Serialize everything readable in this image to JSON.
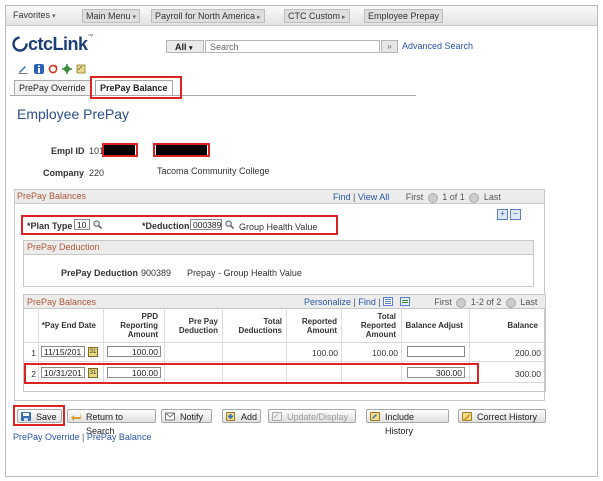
{
  "breadcrumbs": [
    {
      "label": "Favorites",
      "arrow": "▾"
    },
    {
      "label": "Main Menu",
      "arrow": "▾"
    },
    {
      "label": "Payroll for North America",
      "arrow": "▸"
    },
    {
      "label": "CTC Custom",
      "arrow": "▸"
    },
    {
      "label": "Employee Prepay",
      "arrow": ""
    }
  ],
  "header": {
    "logo": "ctcLink",
    "logo_mark": "™",
    "search_scope": "All",
    "search_scope_arrow": "▾",
    "search_placeholder": "Search",
    "search_go": "»",
    "advanced_search": "Advanced Search"
  },
  "tabs": [
    {
      "label": "PrePay Override",
      "active": false
    },
    {
      "label": "PrePay Balance",
      "active": true
    }
  ],
  "page_title": "Employee PrePay",
  "employee": {
    "empl_id_label": "Empl ID",
    "empl_id_prefix": "101",
    "company_label": "Company",
    "company_code": "220",
    "company_name": "Tacoma Community College"
  },
  "prepay_balances": {
    "title": "PrePay Balances",
    "find": "Find",
    "view_all": "View All",
    "first": "First",
    "range": "1 of 1",
    "last": "Last",
    "add_glyph": "+",
    "remove_glyph": "−",
    "plan_type_label": "*Plan Type",
    "plan_type_value": "10",
    "deduction_label": "*Deduction",
    "deduction_value": "000389",
    "deduction_desc": "Group Health Value"
  },
  "prepay_deduction": {
    "title": "PrePay Deduction",
    "label": "PrePay Deduction",
    "code": "900389",
    "desc": "Prepay - Group Health Value"
  },
  "grid": {
    "title": "PrePay Balances",
    "personalize": "Personalize",
    "find": "Find",
    "first": "First",
    "range": "1-2 of 2",
    "last": "Last",
    "columns": {
      "pay_end_date": "*Pay End Date",
      "ppd_reporting": "PPD Reporting Amount",
      "prepay_deduction": "Pre Pay Deduction",
      "total_deductions": "Total Deductions",
      "reported_amount": "Reported Amount",
      "total_reported": "Total Reported Amount",
      "balance_adjust": "Balance Adjust",
      "balance": "Balance"
    },
    "rows": [
      {
        "num": "1",
        "date": "11/15/201",
        "ppd": "100.00",
        "prepay_ded": "",
        "total_ded": "",
        "reported": "100.00",
        "total_reported": "100.00",
        "balance_adjust": "",
        "balance": "200.00"
      },
      {
        "num": "2",
        "date": "10/31/201",
        "ppd": "100.00",
        "prepay_ded": "",
        "total_ded": "",
        "reported": "",
        "total_reported": "",
        "balance_adjust": "300.00",
        "balance": "300.00"
      }
    ]
  },
  "buttons": {
    "save": "Save",
    "return_to_search": "Return to Search",
    "notify": "Notify",
    "add": "Add",
    "update_display": "Update/Display",
    "include_history": "Include History",
    "correct_history": "Correct History"
  },
  "bottom_links": {
    "link1": "PrePay Override",
    "separator": "|",
    "link2": "PrePay Balance"
  },
  "colors": {
    "highlight": "#d22222",
    "link": "#2a55a8",
    "title": "#2a4f8b",
    "group_title": "#b0573a"
  }
}
